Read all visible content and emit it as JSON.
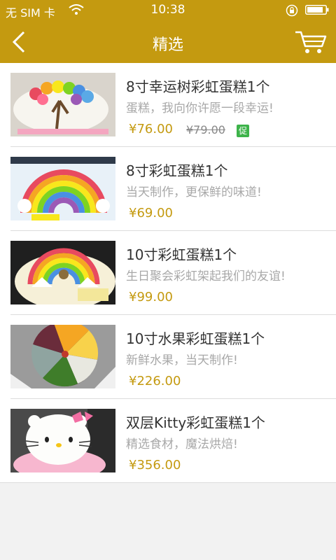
{
  "status_bar": {
    "carrier": "无 SIM 卡",
    "time": "10:38"
  },
  "header": {
    "title": "精选"
  },
  "colors": {
    "accent": "#c49a10",
    "promo_badge": "#3db34a"
  },
  "products": [
    {
      "name": "8寸幸运树彩虹蛋糕1个",
      "desc": "蛋糕，我向你许愿一段幸运!",
      "price": "¥76.00",
      "old_price": "¥79.00",
      "badge": "促"
    },
    {
      "name": "8寸彩虹蛋糕1个",
      "desc": "当天制作，更保鲜的味道!",
      "price": "¥69.00"
    },
    {
      "name": "10寸彩虹蛋糕1个",
      "desc": "生日聚会彩虹架起我们的友谊!",
      "price": "¥99.00"
    },
    {
      "name": "10寸水果彩虹蛋糕1个",
      "desc": "新鲜水果，当天制作!",
      "price": "¥226.00"
    },
    {
      "name": "双层Kitty彩虹蛋糕1个",
      "desc": "精选食材，魔法烘焙!",
      "price": "¥356.00"
    }
  ]
}
